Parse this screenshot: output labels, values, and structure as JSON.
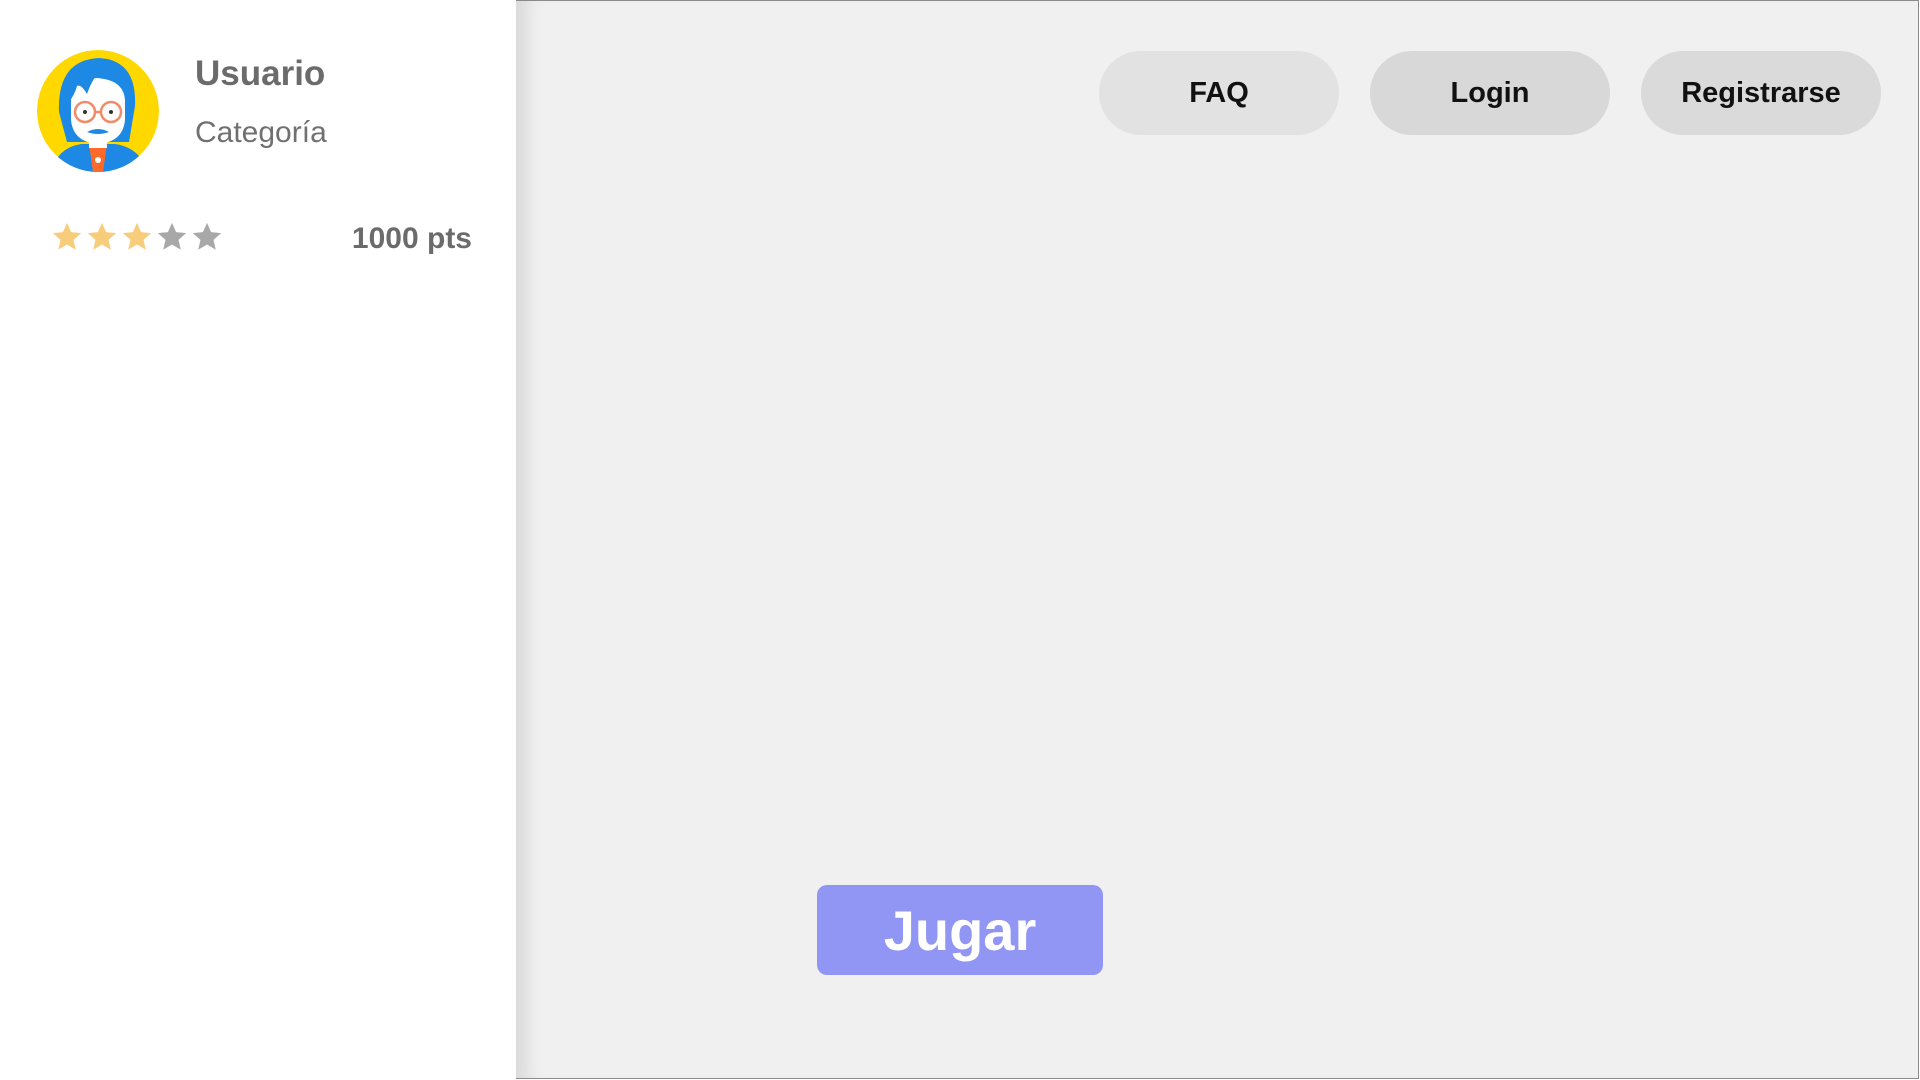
{
  "user": {
    "name": "Usuario",
    "category": "Categoría",
    "points_label": "1000 pts",
    "rating": 3,
    "rating_max": 5
  },
  "nav": {
    "faq_label": "FAQ",
    "login_label": "Login",
    "register_label": "Registrarse"
  },
  "main": {
    "play_label": "Jugar"
  },
  "colors": {
    "star_filled": "#f7cd7c",
    "star_empty": "#a8a8a8",
    "play_button": "#9196f5",
    "avatar_bg": "#ffd800",
    "avatar_hair": "#1e88e5"
  },
  "icons": {
    "avatar": "user-avatar-illustration",
    "star": "star-icon"
  }
}
